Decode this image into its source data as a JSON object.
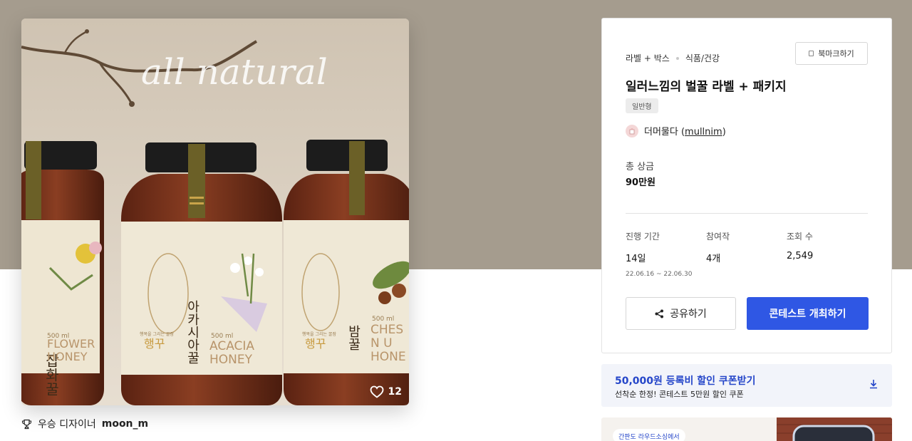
{
  "hero": {
    "image_text": "all natural",
    "likes": "12",
    "bottles": [
      {
        "name_ko": "잡화꿀",
        "volume": "500 ml",
        "name_en_1": "FLOWER",
        "name_en_2": "HONEY",
        "cap_label": "FLOWER HONEY"
      },
      {
        "name_ko": "아카시아꿀",
        "volume": "500 ml",
        "name_en_1": "ACACIA",
        "name_en_2": "HONEY",
        "cap_label": "ACACIA HONEY",
        "brand": "행꾸",
        "tagline": "행복을 그리는 꿀잠"
      },
      {
        "name_ko": "밤꿀",
        "volume": "500 ml",
        "name_en_1": "CHES",
        "name_en_2": "N U",
        "name_en_3": "HONE",
        "cap_label": "CHESTNUT HONEY",
        "brand": "행꾸",
        "tagline": "행복을 그리는 꿀잠"
      }
    ]
  },
  "winner": {
    "prefix": "우승 디자이너",
    "name": "moon_m"
  },
  "panel": {
    "category1": "라벨 + 박스",
    "category2": "식품/건강",
    "bookmark_label": "북마크하기",
    "title": "일러느낌의 벌꿀 라벨 + 패키지",
    "type_tag": "일반형",
    "owner_name": "더머물다 (",
    "owner_handle": "mullnim",
    "owner_close": ")",
    "prize_label": "총 상금",
    "prize_value": "90만원",
    "stats": [
      {
        "label": "진행 기간",
        "value": "14일",
        "dates": "22.06.16 ~ 22.06.30"
      },
      {
        "label": "참여작",
        "value": "4개"
      },
      {
        "label": "조회 수",
        "value": "2,549"
      }
    ],
    "share_label": "공유하기",
    "host_label": "콘테스트 개최하기"
  },
  "coupon": {
    "title": "50,000원 등록비 할인 쿠폰받기",
    "subtitle": "선착순 한정! 콘테스트 5만원 할인 쿠폰"
  },
  "promo": {
    "pill": "간판도 라우드소싱에서"
  },
  "colors": {
    "primary": "#2f57e4",
    "coupon_text": "#2546c9",
    "hero_bg": "#a59c8e"
  }
}
